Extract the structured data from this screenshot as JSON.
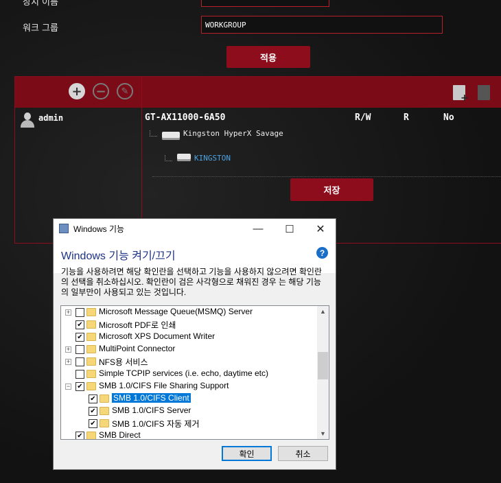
{
  "router": {
    "labels": {
      "device_name": "장치 이름",
      "workgroup": "워크 그룹"
    },
    "workgroup_value": "WORKGROUP",
    "apply_label": "적용",
    "save_label": "저장",
    "user_name": "admin",
    "device_title": "GT-AX11000-6A50",
    "permissions": {
      "rw": "R/W",
      "r": "R",
      "no": "No"
    },
    "drive_name": "Kingston HyperX Savage",
    "partition_name": "KINGSTON"
  },
  "dialog": {
    "title": "Windows 기능",
    "heading": "Windows 기능 켜기/끄기",
    "description": "기능을 사용하려면 해당 확인란을 선택하고 기능을 사용하지 않으려면 확인란의 선택을 취소하십시오. 확인란이 검은 사각형으로 채워진 경우 는 해당 기능의 일부만이 사용되고 있는 것입니다.",
    "features": [
      {
        "label": "Microsoft Message Queue(MSMQ) Server",
        "checked": false,
        "expandable": "+",
        "indent": 0
      },
      {
        "label": "Microsoft PDF로 인쇄",
        "checked": true,
        "expandable": "",
        "indent": 0
      },
      {
        "label": "Microsoft XPS Document Writer",
        "checked": true,
        "expandable": "",
        "indent": 0
      },
      {
        "label": "MultiPoint Connector",
        "checked": false,
        "expandable": "+",
        "indent": 0
      },
      {
        "label": "NFS용 서비스",
        "checked": false,
        "expandable": "+",
        "indent": 0
      },
      {
        "label": "Simple TCPIP services (i.e. echo, daytime etc)",
        "checked": false,
        "expandable": "",
        "indent": 0
      },
      {
        "label": "SMB 1.0/CIFS File Sharing Support",
        "checked": true,
        "expandable": "−",
        "indent": 0
      },
      {
        "label": "SMB 1.0/CIFS Client",
        "checked": true,
        "expandable": "",
        "indent": 1,
        "selected": true
      },
      {
        "label": "SMB 1.0/CIFS Server",
        "checked": true,
        "expandable": "",
        "indent": 1
      },
      {
        "label": "SMB 1.0/CIFS 자동 제거",
        "checked": true,
        "expandable": "",
        "indent": 1
      },
      {
        "label": "SMB Direct",
        "checked": true,
        "expandable": "",
        "indent": 0
      }
    ],
    "ok_label": "확인",
    "cancel_label": "취소",
    "help_icon": "question-icon"
  }
}
